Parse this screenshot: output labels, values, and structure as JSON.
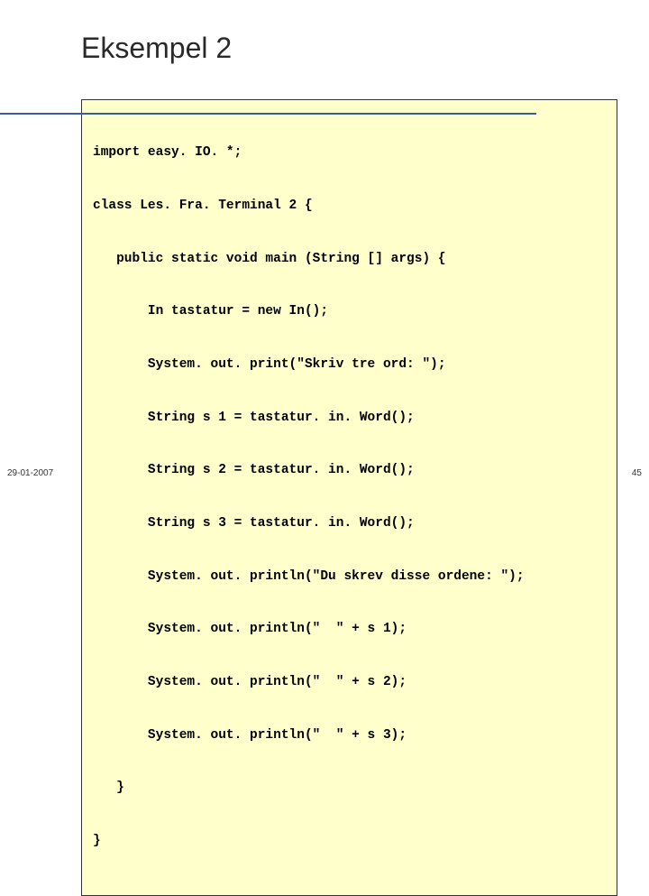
{
  "slide": {
    "title": "Eksempel 2",
    "code_lines": [
      "import easy. IO. *;",
      "class Les. Fra. Terminal 2 {",
      "   public static void main (String [] args) {",
      "       In tastatur = new In();",
      "       System. out. print(\"Skriv tre ord: \");",
      "       String s 1 = tastatur. in. Word();",
      "       String s 2 = tastatur. in. Word();",
      "       String s 3 = tastatur. in. Word();",
      "       System. out. println(\"Du skrev disse ordene: \");",
      "       System. out. println(\"  \" + s 1);",
      "       System. out. println(\"  \" + s 2);",
      "       System. out. println(\"  \" + s 3);",
      "   }",
      "}"
    ],
    "footer_date": "29-01-2007",
    "page_number": "45"
  }
}
